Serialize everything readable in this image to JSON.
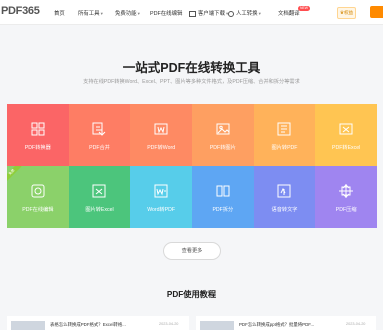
{
  "nav": {
    "logo": "PDF365",
    "items": [
      {
        "label": "首页",
        "caret": false
      },
      {
        "label": "所有工具",
        "caret": true
      },
      {
        "label": "免费功能",
        "caret": true
      },
      {
        "label": "PDF在线编辑",
        "caret": false
      },
      {
        "label": "客户端下载",
        "caret": true
      },
      {
        "label": "人工转换",
        "caret": true
      },
      {
        "label": "文档翻译",
        "caret": false
      }
    ],
    "new_badge": "NEW",
    "vip_label": "权益"
  },
  "hero": {
    "title": "一站式PDF在线转换工具",
    "subtitle": "支持在线PDF转换Word、Excel、PPT、图片等多种文件格式，及PDF压缩、合并和拆分等需求"
  },
  "tools": [
    {
      "label": "PDF转换器",
      "color": "#fb6566",
      "icon": "grid-icon"
    },
    {
      "label": "PDF合并",
      "color": "#fe7d64",
      "icon": "merge-icon"
    },
    {
      "label": "PDF转Word",
      "color": "#fe8a63",
      "icon": "word-icon"
    },
    {
      "label": "PDF转图片",
      "color": "#fe9f61",
      "icon": "image-icon"
    },
    {
      "label": "图片转PDF",
      "color": "#ffb25a",
      "icon": "image-to-pdf-icon"
    },
    {
      "label": "PDF转Excel",
      "color": "#ffc552",
      "icon": "excel-icon"
    },
    {
      "label": "PDF在线编辑",
      "color": "#8bd16a",
      "icon": "edit-icon",
      "ribbon": "免费"
    },
    {
      "label": "图片转Excel",
      "color": "#4cc57c",
      "icon": "image-to-excel-icon"
    },
    {
      "label": "Word转PDF",
      "color": "#57cdea",
      "icon": "word-to-pdf-icon"
    },
    {
      "label": "PDF拆分",
      "color": "#5ea6f3",
      "icon": "split-icon"
    },
    {
      "label": "语音转文字",
      "color": "#7d8df2",
      "icon": "voice-icon"
    },
    {
      "label": "PDF压缩",
      "color": "#9f85f0",
      "icon": "compress-icon"
    }
  ],
  "more_label": "查看更多",
  "section_title": "PDF使用教程",
  "articles": [
    {
      "title": "表格怎么转换成PDF格式？Excel转格...",
      "date": "2023-04-20"
    },
    {
      "title": "PDF怎么转换成ppt格式？批量将PDF...",
      "date": "2023-04-20"
    }
  ]
}
